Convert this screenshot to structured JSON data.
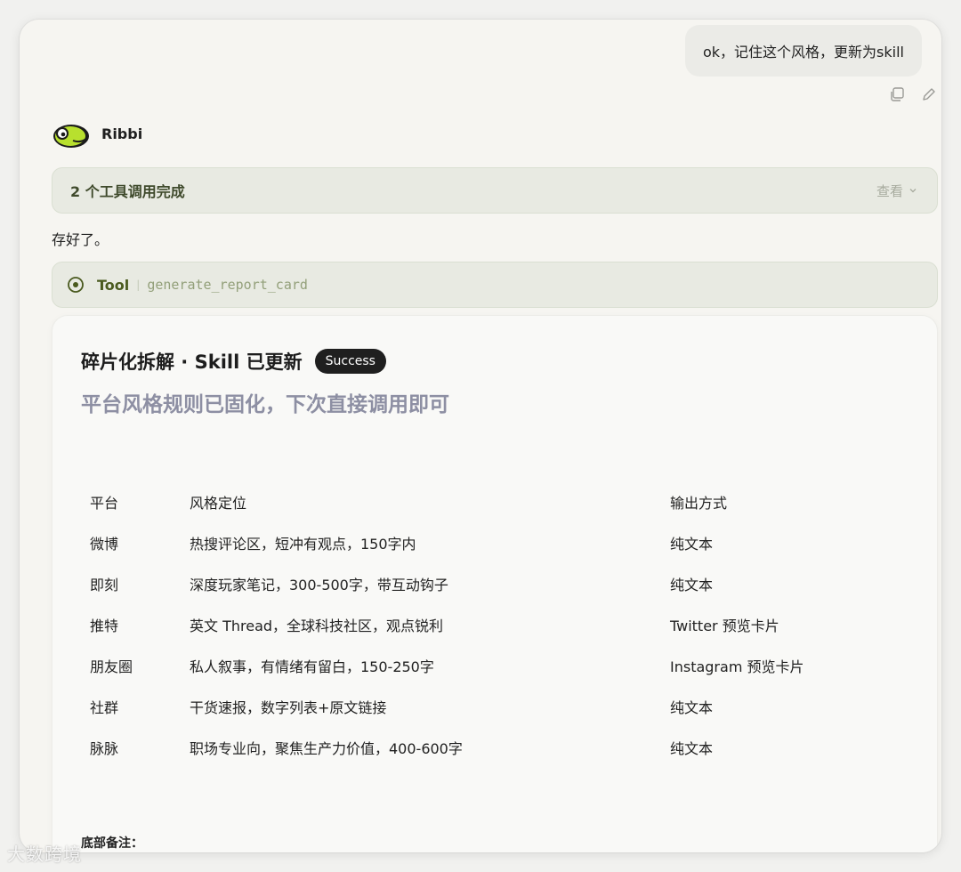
{
  "user_message": {
    "text": "ok，记住这个风格，更新为skill"
  },
  "message_actions": {
    "icons": [
      "copy-icon",
      "edit-icon"
    ]
  },
  "assistant": {
    "name": "Ribbi",
    "avatar_icon": "frog-avatar-icon"
  },
  "tools_summary": {
    "label": "2 个工具调用完成",
    "view_label": "查看"
  },
  "reply_text": "存好了。",
  "tool_call": {
    "label": "Tool",
    "name": "generate_report_card"
  },
  "card": {
    "title": "碎片化拆解 · Skill 已更新",
    "badge": "Success",
    "subtitle": "平台风格规则已固化，下次直接调用即可",
    "table": {
      "headers": [
        "平台",
        "风格定位",
        "输出方式"
      ],
      "rows": [
        [
          "微博",
          "热搜评论区，短冲有观点，150字内",
          "纯文本"
        ],
        [
          "即刻",
          "深度玩家笔记，300-500字，带互动钩子",
          "纯文本"
        ],
        [
          "推特",
          "英文 Thread，全球科技社区，观点锐利",
          "Twitter 预览卡片"
        ],
        [
          "朋友圈",
          "私人叙事，有情绪有留白，150-250字",
          "Instagram 预览卡片"
        ],
        [
          "社群",
          "干货速报，数字列表+原文链接",
          "纯文本"
        ],
        [
          "脉脉",
          "职场专业向，聚焦生产力价值，400-600字",
          "纯文本"
        ]
      ]
    },
    "footer_note": "底部备注："
  },
  "watermark": "大数跨境",
  "colors": {
    "accent_green": "#4a5a1f",
    "badge_bg": "#1f1f1f",
    "subtitle": "#8d8fa3"
  }
}
